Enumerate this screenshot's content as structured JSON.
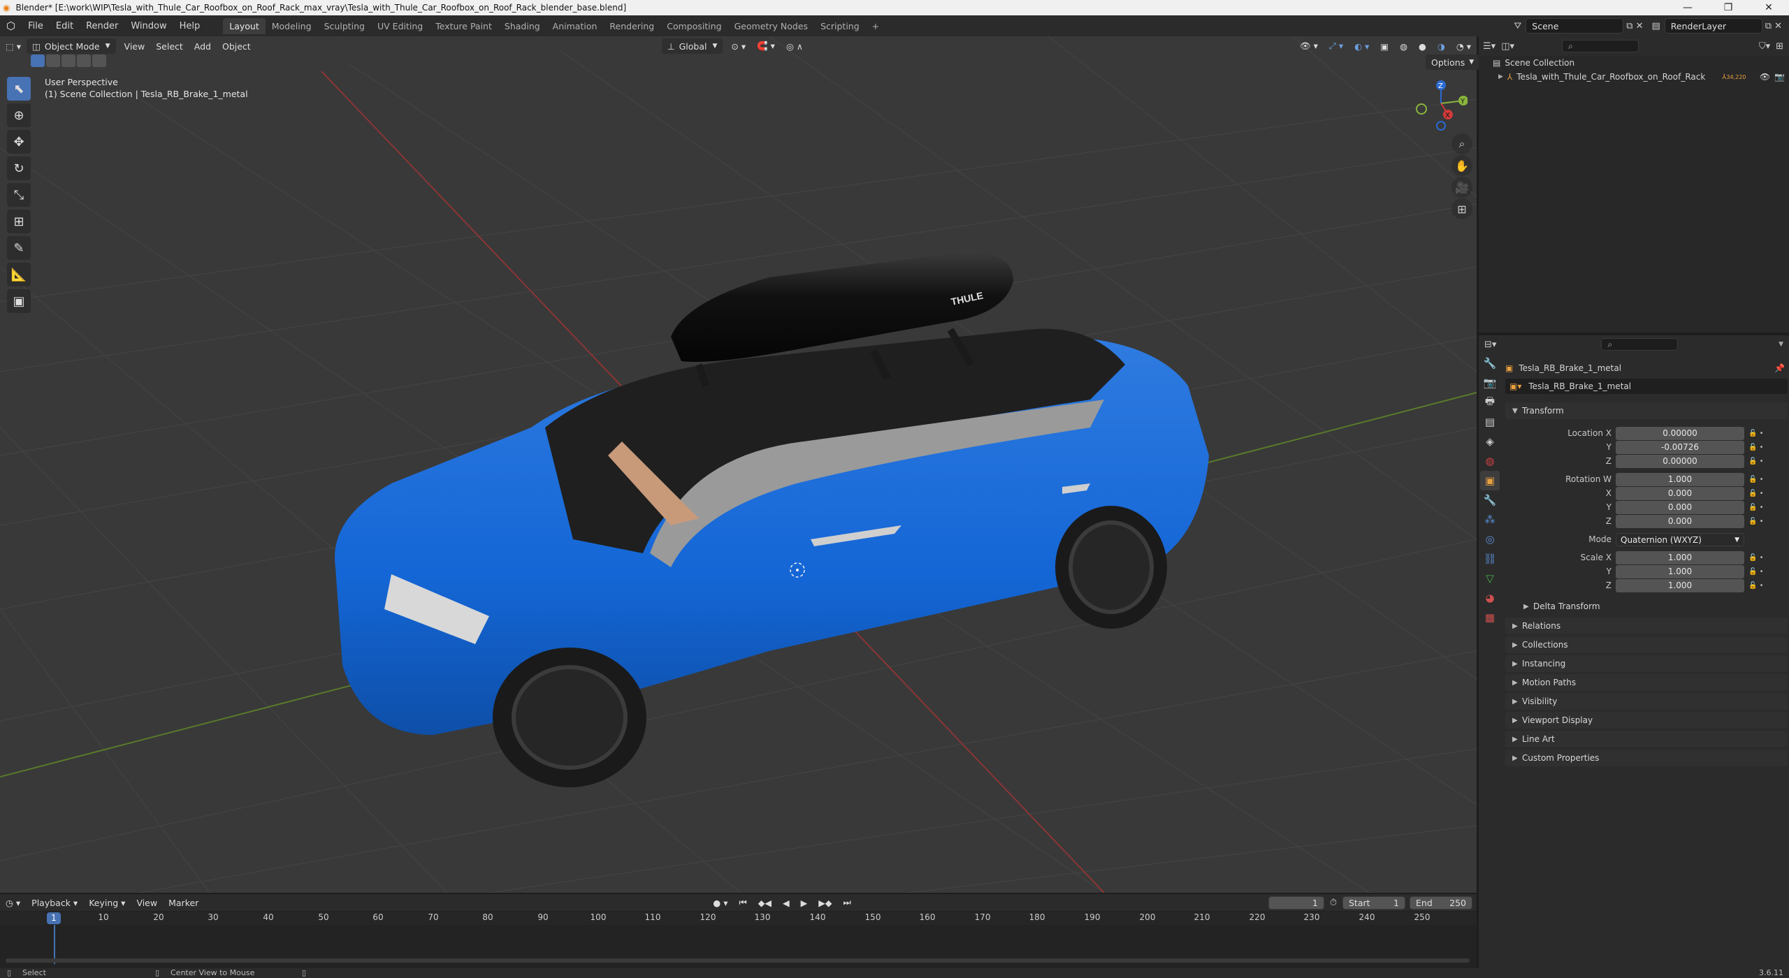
{
  "window": {
    "title": "Blender* [E:\\work\\WIP\\Tesla_with_Thule_Car_Roofbox_on_Roof_Rack_max_vray\\Tesla_with_Thule_Car_Roofbox_on_Roof_Rack_blender_base.blend]",
    "minimize": "—",
    "restore": "❐",
    "close": "✕"
  },
  "menu": {
    "file": "File",
    "edit": "Edit",
    "render": "Render",
    "window": "Window",
    "help": "Help"
  },
  "workspaces": [
    "Layout",
    "Modeling",
    "Sculpting",
    "UV Editing",
    "Texture Paint",
    "Shading",
    "Animation",
    "Rendering",
    "Compositing",
    "Geometry Nodes",
    "Scripting"
  ],
  "active_workspace": "Layout",
  "add_workspace": "+",
  "scene": {
    "name": "Scene",
    "view_layer": "RenderLayer"
  },
  "viewport": {
    "mode": "Object Mode",
    "view_menu": "View",
    "select_menu": "Select",
    "add_menu": "Add",
    "object_menu": "Object",
    "orientation": "Global",
    "options": "Options",
    "perspective_label": "User Perspective",
    "collection_label": "(1) Scene Collection | Tesla_RB_Brake_1_metal",
    "gizmo": {
      "x": "X",
      "y": "Y",
      "z": "Z"
    },
    "roofbox_brand": "THULE"
  },
  "tools": [
    "select-box",
    "cursor",
    "move",
    "rotate",
    "scale",
    "transform",
    "annotate",
    "measure",
    "add-cube"
  ],
  "outliner": {
    "root": "Scene Collection",
    "item": "Tesla_with_Thule_Car_Roofbox_on_Roof_Rack",
    "item_badge": "34,220"
  },
  "properties": {
    "object_name": "Tesla_RB_Brake_1_metal",
    "data_name": "Tesla_RB_Brake_1_metal",
    "transform_title": "Transform",
    "location": {
      "label_x": "Location X",
      "label_y": "Y",
      "label_z": "Z",
      "x": "0.00000",
      "y": "-0.00726",
      "z": "0.00000"
    },
    "rotation": {
      "label_w": "Rotation W",
      "label_x": "X",
      "label_y": "Y",
      "label_z": "Z",
      "w": "1.000",
      "x": "0.000",
      "y": "0.000",
      "z": "0.000"
    },
    "mode": {
      "label": "Mode",
      "value": "Quaternion (WXYZ)"
    },
    "scale": {
      "label_x": "Scale X",
      "label_y": "Y",
      "label_z": "Z",
      "x": "1.000",
      "y": "1.000",
      "z": "1.000"
    },
    "delta_transform": "Delta Transform",
    "sections": [
      "Relations",
      "Collections",
      "Instancing",
      "Motion Paths",
      "Visibility",
      "Viewport Display",
      "Line Art",
      "Custom Properties"
    ]
  },
  "timeline": {
    "playback": "Playback",
    "keying": "Keying",
    "view": "View",
    "marker": "Marker",
    "current_frame": "1",
    "start_label": "Start",
    "start": "1",
    "end_label": "End",
    "end": "250",
    "ruler": [
      "10",
      "20",
      "30",
      "40",
      "50",
      "60",
      "70",
      "80",
      "90",
      "100",
      "110",
      "120",
      "130",
      "140",
      "150",
      "160",
      "170",
      "180",
      "190",
      "200",
      "210",
      "220",
      "230",
      "240",
      "250"
    ],
    "playhead": "1"
  },
  "status": {
    "select": "Select",
    "center": "Center View to Mouse",
    "version": "3.6.11"
  }
}
